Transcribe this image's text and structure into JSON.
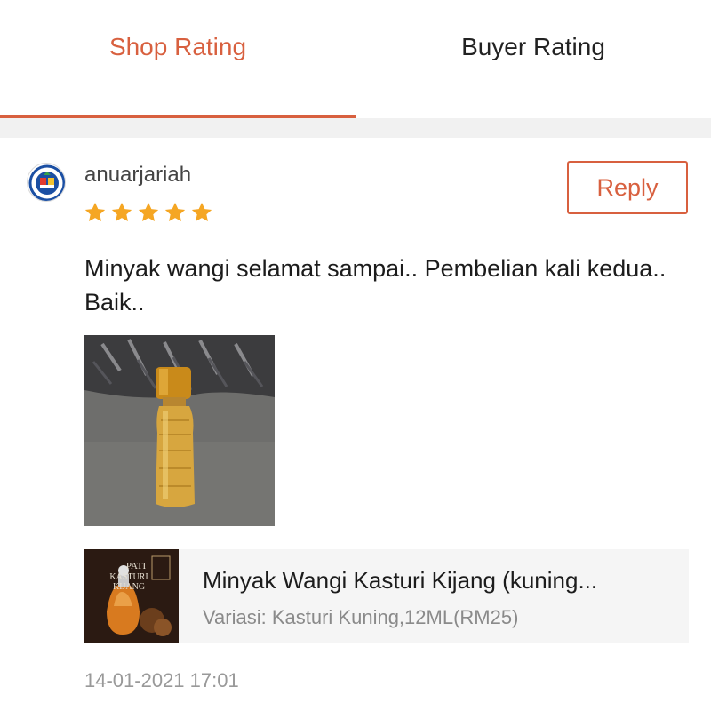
{
  "tabs": {
    "shop_label": "Shop Rating",
    "buyer_label": "Buyer Rating",
    "active": "Shop Rating"
  },
  "review": {
    "username": "anuarjariah",
    "rating": 5,
    "rating_max": 5,
    "reply_label": "Reply",
    "comment": "Minyak wangi selamat sampai.. Pembelian kali kedua.. Baik..",
    "product": {
      "name": "Minyak Wangi Kasturi Kijang (kuning...",
      "variant": "Variasi: Kasturi Kuning,12ML(RM25)",
      "thumb_text_line1": "PATI",
      "thumb_text_line2": "KASTURI",
      "thumb_text_line3": "KIJANG"
    },
    "timestamp": "14-01-2021 17:01"
  },
  "colors": {
    "accent": "#d8603f",
    "star": "#f5a623",
    "divider": "#f1f1f1"
  },
  "icons": {
    "avatar": "shop-logo-avatar",
    "star": "star-icon"
  }
}
